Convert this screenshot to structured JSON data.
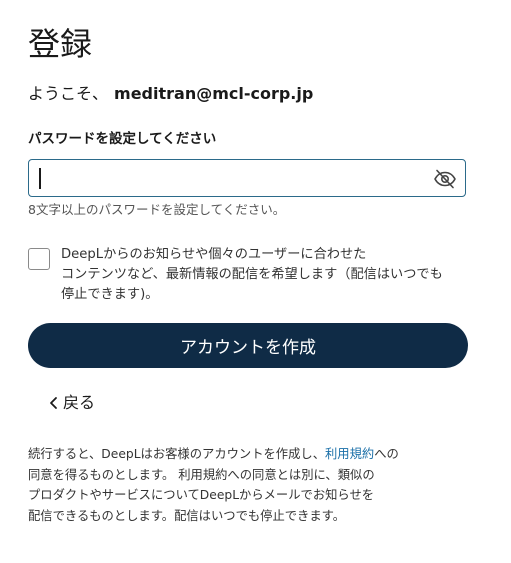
{
  "title": "登録",
  "welcome": {
    "greeting": "ようこそ、",
    "email": "meditran@mcl-corp.jp"
  },
  "password": {
    "label": "パスワードを設定してください",
    "value": "",
    "hint": "8文字以上のパスワードを設定してください。",
    "toggle_icon": "eye-slash-icon"
  },
  "marketing_opt_in": {
    "checked": false,
    "lines": [
      "DeepLからのお知らせや個々のユーザーに合わせた",
      "コンテンツなど、最新情報の配信を希望します（配信はいつでも",
      "停止できます)。"
    ]
  },
  "create_button": {
    "label": "アカウントを作成"
  },
  "back": {
    "label": "戻る",
    "icon": "chevron-left-icon"
  },
  "legal": {
    "line1_prefix": "続行すると、DeepLはお客様のアカウントを作成し、",
    "terms_link": "利用規約",
    "line1_suffix": "への",
    "line2": "同意を得るものとします。 利用規約への同意とは別に、類似の",
    "line3": "プロダクトやサービスについてDeepLからメールでお知らせを",
    "line4": "配信できるものとします。配信はいつでも停止できます。"
  },
  "colors": {
    "primary_button": "#0f2b46",
    "link": "#1a6fa8",
    "input_border": "#2b6a8a"
  }
}
